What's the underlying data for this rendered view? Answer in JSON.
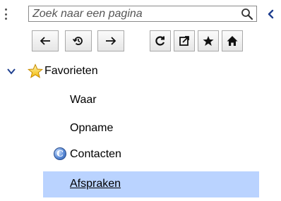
{
  "search": {
    "placeholder": "Zoek naar een pagina",
    "value": ""
  },
  "toolbar": {
    "buttons": [
      {
        "name": "back",
        "icon": "arrow-left-icon"
      },
      {
        "name": "history",
        "icon": "history-icon"
      },
      {
        "name": "forward",
        "icon": "arrow-right-icon"
      },
      {
        "name": "refresh",
        "icon": "refresh-icon"
      },
      {
        "name": "open-external",
        "icon": "external-link-icon"
      },
      {
        "name": "favorite",
        "icon": "star-icon"
      },
      {
        "name": "home",
        "icon": "home-icon"
      }
    ]
  },
  "tree": {
    "group_label": "Favorieten",
    "items": [
      {
        "label": "Waar",
        "icon": null
      },
      {
        "label": "Opname",
        "icon": null
      },
      {
        "label": "Contacten",
        "icon": "c-badge-icon"
      },
      {
        "label": "Afspraken",
        "icon": null,
        "selected": true
      }
    ]
  },
  "colors": {
    "selection": "#bad3ff",
    "collapse_arrow": "#1f3f8f"
  }
}
